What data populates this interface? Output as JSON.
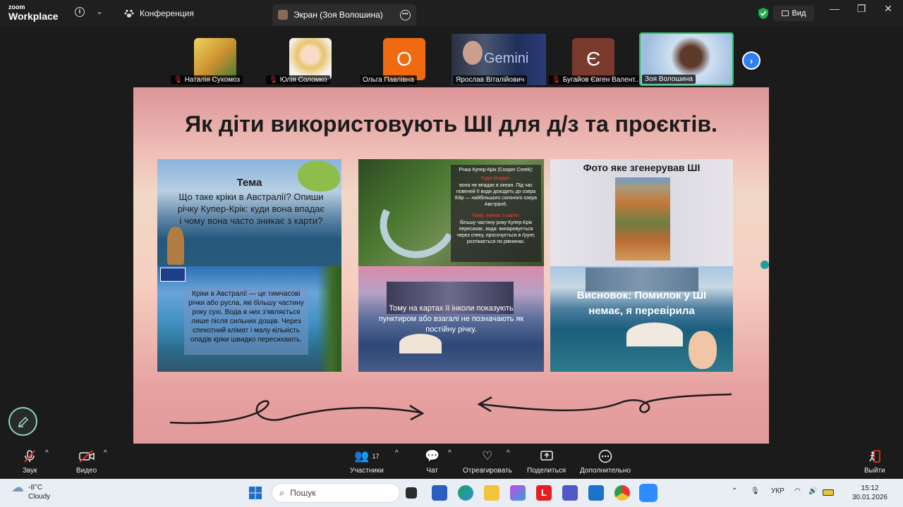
{
  "app": {
    "logo_top": "zoom",
    "logo_bottom": "Workplace",
    "view_label": "Вид"
  },
  "tabs": {
    "conference": "Конференция",
    "share": "Экран (Зоя Волошина)"
  },
  "participants": [
    {
      "name": "Наталія Сухомоз",
      "muted": true,
      "color": "#d9b949"
    },
    {
      "name": "Юлія Соломко",
      "muted": true,
      "color": "#e8d3b8"
    },
    {
      "name": "Ольга Павлівна",
      "muted": false,
      "initial": "О",
      "color": "#f06a12"
    },
    {
      "name": "Ярослав Віталійович",
      "muted": false,
      "color": "#3c4a66"
    },
    {
      "name": "Бугайов Євген Валент...",
      "muted": true,
      "initial": "Є",
      "color": "#7a3b2e"
    },
    {
      "name": "Зоя Волошина",
      "muted": false,
      "color": "#8fb1d4",
      "active": true
    }
  ],
  "slide": {
    "title": "Як діти використовують ШІ для д/з та проєктів.",
    "topic_heading": "Тема",
    "topic_text": "Що таке кріки в Австралії? Опиши річку Купер-Крік: куди вона впадає і чому вона часто зникає з карти?",
    "river_title": "Річка Купер-Крік (Cooper Creek):",
    "river_red1": "Куди впадає:",
    "river_text1": "вона не впадає в океан. Під час повеней її води доходять до озера Ейр — найбільшого солоного озера Австралії.",
    "river_red2": "Чому зникає з карти:",
    "river_text2": "більшу частину року Купер-Крік пересихає, вода: випаровується через спеку, просочується в ґрунт, розтікається по рівнинах.",
    "ai_photo_caption": "Фото яке згенерував ШІ",
    "creeks_text": "Кріки в Австралії — це тимчасові річки або русла, які більшу частину року сухі. Вода в них з'являється лише після сильних дощів. Через спекотний клімат і малу кількість опадів кріки швидко пересихають.",
    "maps_text": "Тому на картах її інколи показують пунктиром або взагалі не позначають як постійну річку.",
    "conclusion": "Висновок: Помилок у ШІ немає, я перевірила"
  },
  "toolbar": {
    "sound": "Звук",
    "video": "Видео",
    "participants": "Участники",
    "participants_count": "17",
    "chat": "Чат",
    "react": "Отреагировать",
    "share": "Поделиться",
    "more": "Дополнительно",
    "leave": "Выйти"
  },
  "taskbar": {
    "temp": "-8°C",
    "weather": "Cloudy",
    "search_placeholder": "Пошук",
    "lang": "УКР",
    "time": "15:12",
    "date": "30.01.2026"
  }
}
